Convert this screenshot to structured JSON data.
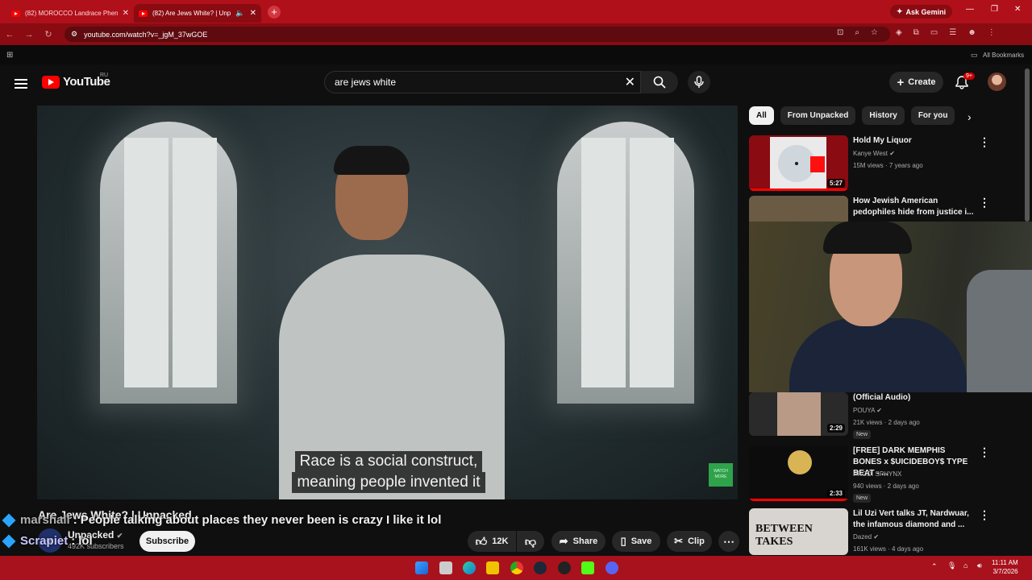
{
  "browser": {
    "tabs": [
      {
        "title": "(82) MOROCCO Landrace Phen",
        "active": false
      },
      {
        "title": "(82) Are Jews White? | Unp",
        "active": true
      }
    ],
    "url": "youtube.com/watch?v=_jgM_37wGOE",
    "ask_gemini": "Ask Gemini",
    "all_bookmarks": "All Bookmarks"
  },
  "youtube": {
    "logo": "YouTube",
    "region": "RU",
    "search_value": "are jews white",
    "create_label": "Create",
    "notif_count": "9+"
  },
  "video": {
    "subtitle_line1": "Race is a social construct,",
    "subtitle_line2": "meaning people invented it",
    "watch_more": "WATCH MORE",
    "title": "Are Jews White? | Unpacked",
    "channel": "Unpacked",
    "subscribers": "492K subscribers",
    "avatar_text": "un",
    "subscribe_label": "Subscribe",
    "likes": "12K",
    "share_label": "Share",
    "save_label": "Save",
    "clip_label": "Clip"
  },
  "chat_overlay": [
    {
      "user": "marshall",
      "message": "People talking about places they never been is crazy I like it lol"
    },
    {
      "user": "Scrapiet",
      "message": "lol"
    }
  ],
  "chips": [
    "All",
    "From Unpacked",
    "History",
    "For you"
  ],
  "recommendations": [
    {
      "title": "Hold My Liquor",
      "channel": "Kanye West",
      "meta": "15M views · 7 years ago",
      "duration": "5:27",
      "progress": 1.0
    },
    {
      "title": "How Jewish American pedophiles hide from justice i...",
      "channel": "",
      "meta": "",
      "duration": ""
    },
    {
      "title": "(Official Audio)",
      "channel": "POUYA",
      "meta": "21K views · 2 days ago",
      "duration": "2:29",
      "badge": "New"
    },
    {
      "title": "[FREE] DARK MEMPHIS BONES x $UICIDEBOY$ TYPE BEAT - ...",
      "channel": "PROD. SPHYNX",
      "meta": "940 views · 2 days ago",
      "duration": "2:33",
      "badge": "New",
      "progress": 1.0
    },
    {
      "title": "Lil Uzi Vert talks JT, Nardwuar, the infamous diamond and ...",
      "channel": "Dazed",
      "meta": "161K views · 4 days ago",
      "duration": ""
    }
  ],
  "taskbar": {
    "time": "11:11 AM",
    "date": "3/7/2026"
  }
}
